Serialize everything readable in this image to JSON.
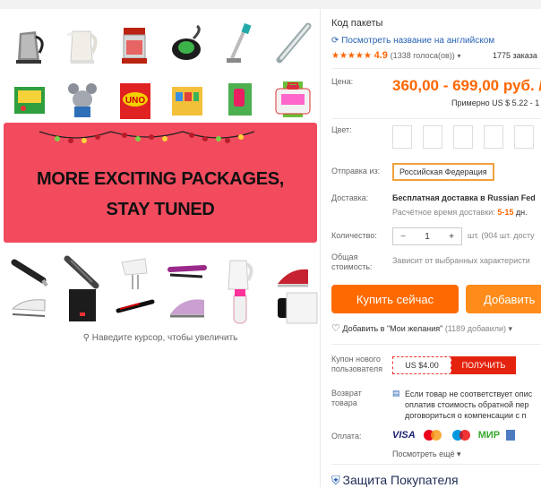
{
  "gallery": {
    "promo_line1": "MORE EXCITING PACKAGES,",
    "promo_line2": "STAY TUNED",
    "zoom_hint": "Наведите курсор, чтобы увеличить"
  },
  "product": {
    "title": "Код пакеты",
    "translate_link": "Посмотреть название на английском",
    "rating_value": "4.9",
    "rating_count": "(1338 голоса(ов))",
    "orders": "1775 заказа",
    "price_label": "Цена:",
    "price_value": "360,00 - 699,00 руб. /",
    "price_approx": "Примерно US $ 5.22 - 1",
    "color_label": "Цвет:",
    "ship_label": "Отправка из:",
    "ship_country": "Российская Федерация",
    "delivery_label": "Доставка:",
    "delivery_value": "Бесплатная доставка в Russian Fed",
    "delivery_time_prefix": "Расчётное время доставки:",
    "delivery_time_days": "5-15",
    "delivery_time_unit": "дн.",
    "qty_label": "Количество:",
    "qty_value": "1",
    "qty_minus": "−",
    "qty_plus": "+",
    "qty_note": "шт. (904 шт. досту",
    "total_label_1": "Общая",
    "total_label_2": "стоимость:",
    "total_value": "Зависит от выбранных характеристи",
    "buy_now": "Купить сейчас",
    "add_to_cart": "Добавить",
    "wishlist": "Добавить в \"Мои желания\"",
    "wishlist_count": "(1189 добавили)",
    "coupon_label_1": "Купон нового",
    "coupon_label_2": "пользователя",
    "coupon_value": "US $4.00",
    "coupon_get": "ПОЛУЧИТЬ",
    "return_label_1": "Возврат",
    "return_label_2": "товара",
    "return_text_1": "Если товар не соответствует опис",
    "return_text_2": "оплатив стоимость обратной пер",
    "return_text_3": "договориться о компенсации с п",
    "payment_label": "Оплата:",
    "pay_visa": "VISA",
    "pay_mir": "МИР",
    "more_payments": "Посмотреть ещё",
    "protection": "Защита Покупателя"
  },
  "colors": {
    "accent": "#ff6a00",
    "buy": "#ff4747",
    "promo": "#f24b5e",
    "link": "#2862b5"
  }
}
